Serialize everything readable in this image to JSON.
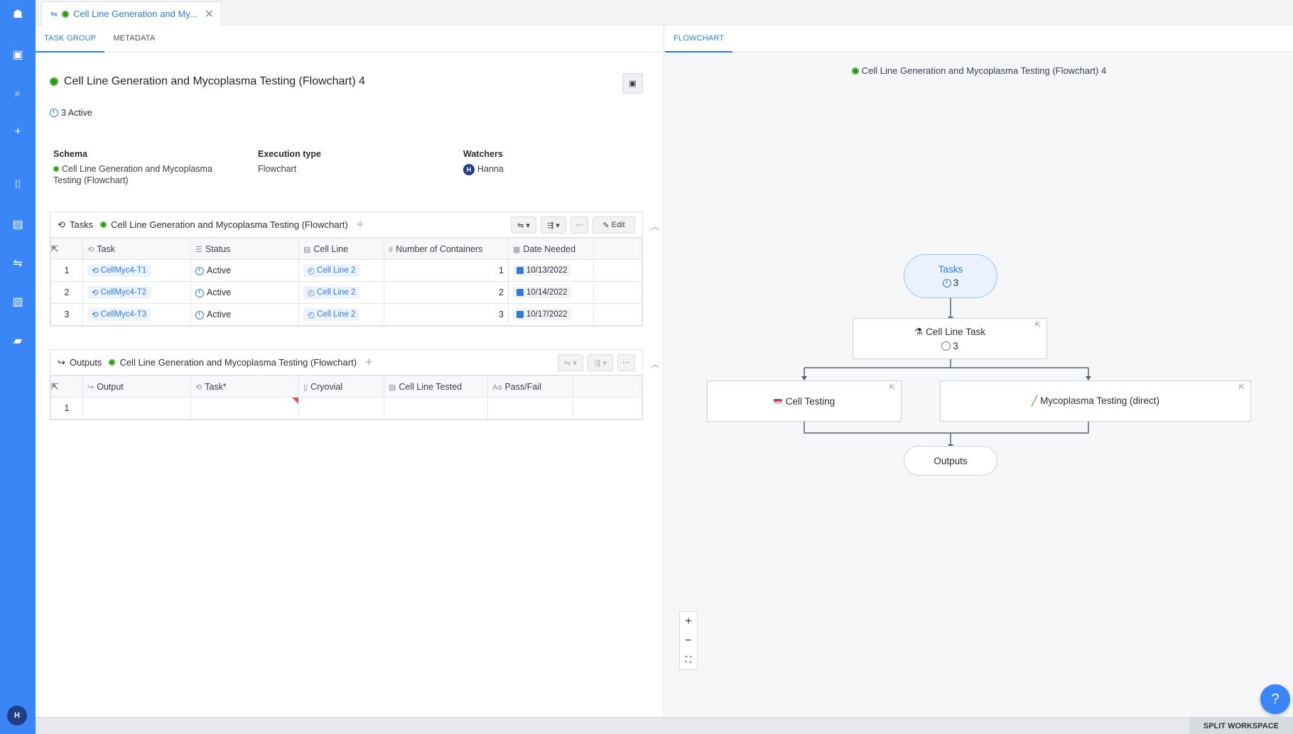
{
  "doc_tab": {
    "title": "Cell Line Generation and My...",
    "close": "✕"
  },
  "left_tabs": [
    "TASK GROUP",
    "METADATA"
  ],
  "right_tabs": [
    "FLOWCHART"
  ],
  "header": {
    "title": "Cell Line Generation and Mycoplasma Testing (Flowchart) 4",
    "status": "3 Active"
  },
  "meta": {
    "schema_label": "Schema",
    "schema_value": "Cell Line Generation and Mycoplasma Testing (Flowchart)",
    "exec_label": "Execution type",
    "exec_value": "Flowchart",
    "watchers_label": "Watchers",
    "watcher_initial": "H",
    "watcher_name": "Hanna"
  },
  "tasks_card": {
    "label": "Tasks",
    "schema": "Cell Line Generation and Mycoplasma Testing (Flowchart)",
    "edit_label": "Edit",
    "columns": [
      "Task",
      "Status",
      "Cell Line",
      "Number of Containers",
      "Date Needed"
    ],
    "rows": [
      {
        "no": "1",
        "task": "CellMyc4-T1",
        "status": "Active",
        "cell_line": "Cell Line 2",
        "containers": "1",
        "date": "10/13/2022"
      },
      {
        "no": "2",
        "task": "CellMyc4-T2",
        "status": "Active",
        "cell_line": "Cell Line 2",
        "containers": "2",
        "date": "10/14/2022"
      },
      {
        "no": "3",
        "task": "CellMyc4-T3",
        "status": "Active",
        "cell_line": "Cell Line 2",
        "containers": "3",
        "date": "10/17/2022"
      }
    ]
  },
  "outputs_card": {
    "label": "Outputs",
    "schema": "Cell Line Generation and Mycoplasma Testing (Flowchart)",
    "columns": [
      "Output",
      "Task*",
      "Cryovial",
      "Cell Line Tested",
      "Pass/Fail"
    ],
    "rows": [
      {
        "no": "1"
      }
    ]
  },
  "flowchart": {
    "title": "Cell Line Generation and Mycoplasma Testing (Flowchart) 4",
    "nodes": {
      "tasks": {
        "label": "Tasks",
        "count": "3"
      },
      "cell_line_task": {
        "label": "Cell Line Task",
        "count": "3"
      },
      "cell_testing": {
        "label": "Cell Testing"
      },
      "mycoplasma": {
        "label": "Mycoplasma Testing (direct)"
      },
      "outputs": {
        "label": "Outputs"
      }
    },
    "zoom": {
      "in": "+",
      "out": "−",
      "fit": "⛶"
    }
  },
  "status_bar": {
    "split_workspace": "SPLIT WORKSPACE"
  },
  "help": "?",
  "user_initial": "H",
  "colors": {
    "accent": "#3b86f7",
    "link": "#2f7ae5",
    "schema_dot": "#2f8f2f"
  }
}
